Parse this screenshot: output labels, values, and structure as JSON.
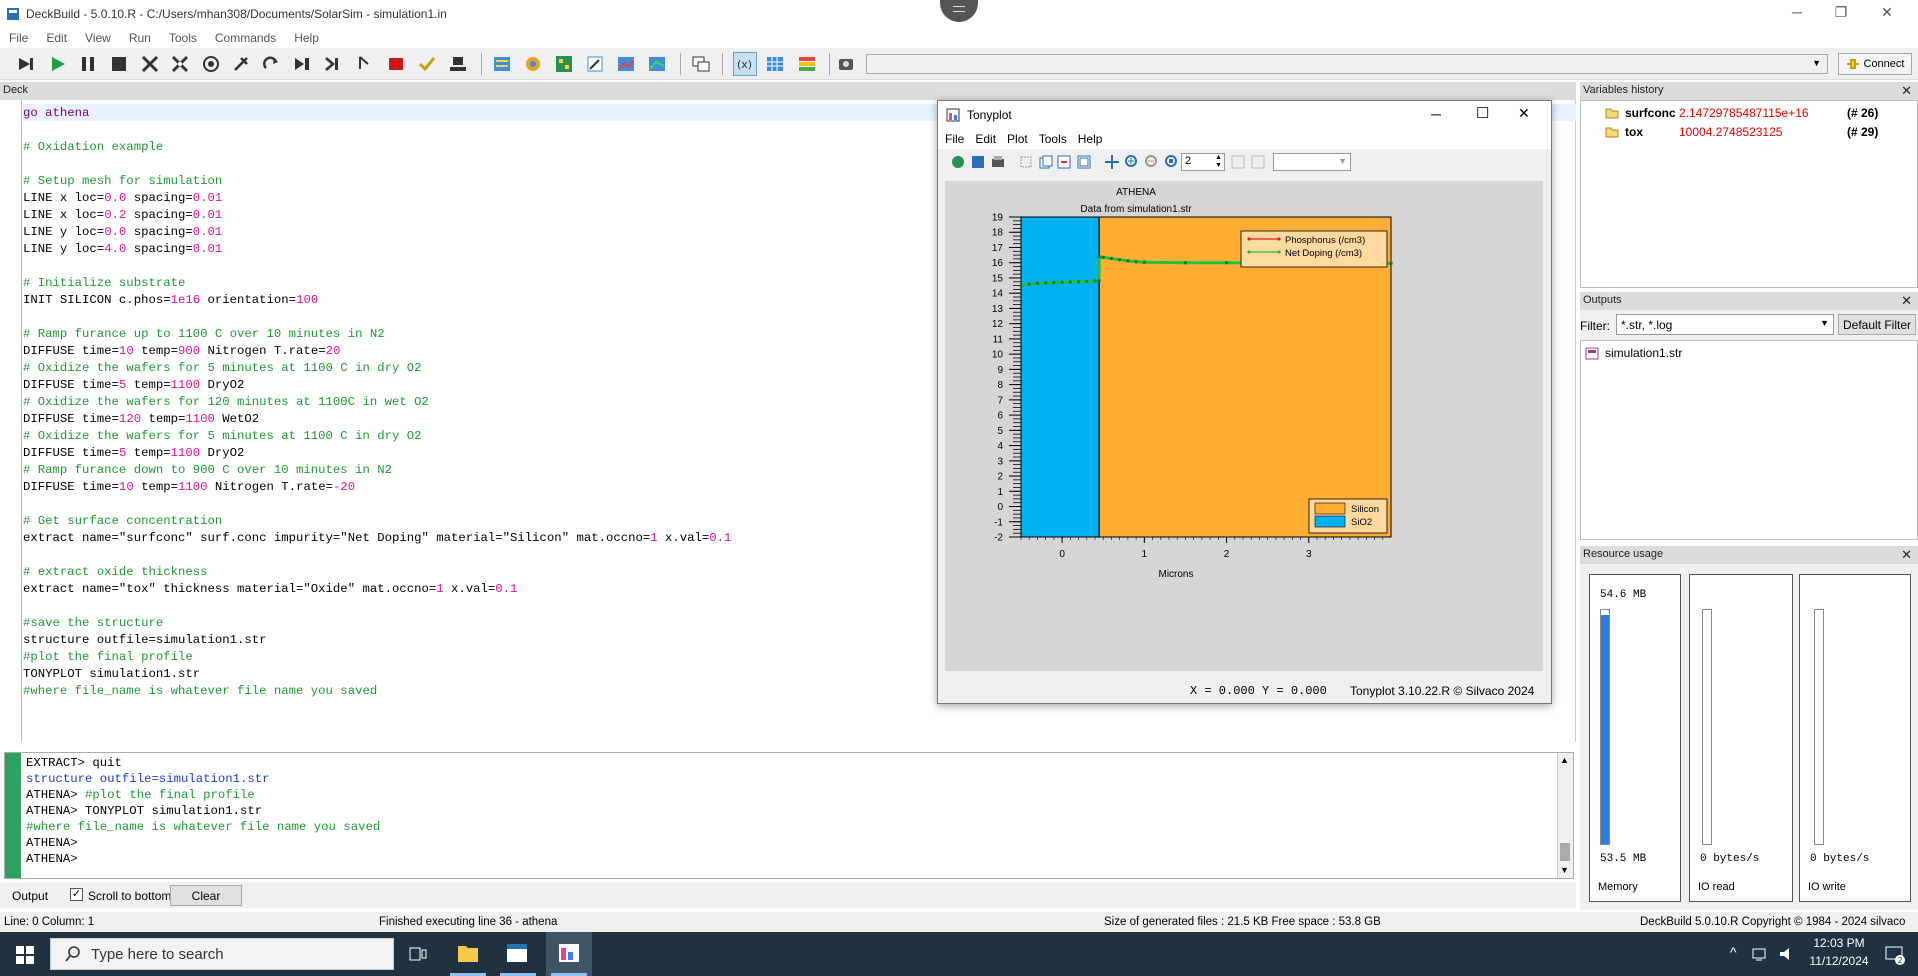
{
  "window": {
    "title": "DeckBuild - 5.0.10.R - C:/Users/mhan308/Documents/SolarSim - simulation1.in"
  },
  "menu": [
    "File",
    "Edit",
    "View",
    "Run",
    "Tools",
    "Commands",
    "Help"
  ],
  "toolbar": {
    "connect_label": "Connect"
  },
  "deck": {
    "header": "Deck",
    "lines": [
      {
        "t": "go athena",
        "c": "go"
      },
      {
        "t": "",
        "c": "kw"
      },
      {
        "t": "# Oxidation example",
        "c": "comment"
      },
      {
        "t": "",
        "c": "kw"
      },
      {
        "t": "# Setup mesh for simulation",
        "c": "comment"
      },
      {
        "t": "LINE x loc=0.0 spacing=0.01",
        "c": "kw"
      },
      {
        "t": "LINE x loc=0.2 spacing=0.01",
        "c": "kw"
      },
      {
        "t": "LINE y loc=0.0 spacing=0.01",
        "c": "kw"
      },
      {
        "t": "LINE y loc=4.0 spacing=0.01",
        "c": "kw"
      },
      {
        "t": "",
        "c": "kw"
      },
      {
        "t": "# Initialize substrate",
        "c": "comment"
      },
      {
        "t": "INIT SILICON c.phos=1e16 orientation=100",
        "c": "kw"
      },
      {
        "t": "",
        "c": "kw"
      },
      {
        "t": "# Ramp furance up to 1100 C over 10 minutes in N2",
        "c": "comment"
      },
      {
        "t": "DIFFUSE time=10 temp=900 Nitrogen T.rate=20",
        "c": "kw"
      },
      {
        "t": "# Oxidize the wafers for 5 minutes at 1100 C in dry O2",
        "c": "comment"
      },
      {
        "t": "DIFFUSE time=5 temp=1100 DryO2",
        "c": "kw"
      },
      {
        "t": "# Oxidize the wafers for 120 minutes at 1100C in wet O2",
        "c": "comment"
      },
      {
        "t": "DIFFUSE time=120 temp=1100 WetO2",
        "c": "kw"
      },
      {
        "t": "# Oxidize the wafers for 5 minutes at 1100 C in dry O2",
        "c": "comment"
      },
      {
        "t": "DIFFUSE time=5 temp=1100 DryO2",
        "c": "kw"
      },
      {
        "t": "# Ramp furance down to 900 C over 10 minutes in N2",
        "c": "comment"
      },
      {
        "t": "DIFFUSE time=10 temp=1100 Nitrogen T.rate=-20",
        "c": "kw"
      },
      {
        "t": "",
        "c": "kw"
      },
      {
        "t": "# Get surface concentration",
        "c": "comment"
      },
      {
        "t": "extract name=\"surfconc\" surf.conc impurity=\"Net Doping\" material=\"Silicon\" mat.occno=1 x.val=0.1",
        "c": "kw"
      },
      {
        "t": "",
        "c": "kw"
      },
      {
        "t": "# extract oxide thickness",
        "c": "comment"
      },
      {
        "t": "extract name=\"tox\" thickness material=\"Oxide\" mat.occno=1 x.val=0.1",
        "c": "kw"
      },
      {
        "t": "",
        "c": "kw"
      },
      {
        "t": "#save the structure",
        "c": "comment"
      },
      {
        "t": "structure outfile=simulation1.str",
        "c": "kw"
      },
      {
        "t": "#plot the final profile",
        "c": "comment"
      },
      {
        "t": "TONYPLOT simulation1.str",
        "c": "kw"
      },
      {
        "t": "#where file_name is whatever file name you saved",
        "c": "comment"
      }
    ]
  },
  "output": {
    "lines": [
      {
        "t": "EXTRACT> quit",
        "c": "plain"
      },
      {
        "t": "structure outfile=simulation1.str",
        "c": "blue"
      },
      {
        "t": "ATHENA> #plot the final profile",
        "c": "mixed"
      },
      {
        "t": "ATHENA> TONYPLOT simulation1.str",
        "c": "plain"
      },
      {
        "t": "#where file_name is whatever file name you saved",
        "c": "green"
      },
      {
        "t": "ATHENA>",
        "c": "plain"
      },
      {
        "t": "ATHENA>",
        "c": "plain"
      }
    ],
    "tab_label": "Output",
    "scroll_label": "Scroll to bottom",
    "clear_label": "Clear"
  },
  "variables": {
    "header": "Variables history",
    "items": [
      {
        "name": "surfconc",
        "value": "2.14729785487115e+16",
        "idx": "(# 26)"
      },
      {
        "name": "tox",
        "value": "10004.2748523125",
        "idx": "(# 29)"
      }
    ]
  },
  "outputs": {
    "header": "Outputs",
    "filter_label": "Filter:",
    "filter_value": "*.str, *.log",
    "default_filter": "Default Filter",
    "files": [
      "simulation1.str"
    ]
  },
  "resources": {
    "header": "Resource usage",
    "memory_top": "54.6 MB",
    "memory_bottom": "53.5 MB",
    "memory_label": "Memory",
    "memory_fill": 0.98,
    "ioread_val": "0 bytes/s",
    "ioread_label": "IO read",
    "iowrite_val": "0 bytes/s",
    "iowrite_label": "IO write"
  },
  "status": {
    "position": "Line: 0 Column: 1",
    "message": "Finished executing line 36 - athena",
    "sizes": "Size of generated files : 21.5 KB  Free space : 53.8 GB",
    "copyright": "DeckBuild 5.0.10.R Copyright © 1984 - 2024 silvaco"
  },
  "tonyplot": {
    "title": "Tonyplot",
    "menu": [
      "File",
      "Edit",
      "Plot",
      "Tools",
      "Help"
    ],
    "zoom_value": "2",
    "status_xy": "X = 0.000 Y = 0.000",
    "status_ver": "Tonyplot 3.10.22.R © Silvaco 2024"
  },
  "chart_data": {
    "type": "line",
    "title": "ATHENA",
    "subtitle": "Data from simulation1.str",
    "xlabel": "Microns",
    "ylabel": "",
    "xlim": [
      -0.5,
      4.0
    ],
    "ylim": [
      -2,
      19
    ],
    "xticks": [
      0,
      1,
      2,
      3
    ],
    "yticks": [
      -2,
      -1,
      0,
      1,
      2,
      3,
      4,
      5,
      6,
      7,
      8,
      9,
      10,
      11,
      12,
      13,
      14,
      15,
      16,
      17,
      18,
      19
    ],
    "regions": [
      {
        "name": "SiO2",
        "x": [
          -0.5,
          0.45
        ],
        "color": "#00b3f0"
      },
      {
        "name": "Silicon",
        "x": [
          0.45,
          4.0
        ],
        "color": "#ffae33"
      }
    ],
    "series": [
      {
        "name": "Phosphorus (/cm3)",
        "color": "#e02020",
        "x": [
          0.45,
          0.5,
          0.6,
          0.7,
          0.8,
          0.9,
          1.0,
          1.5,
          2.0,
          2.5,
          3.0,
          3.5,
          4.0
        ],
        "y": [
          16.4,
          16.35,
          16.28,
          16.2,
          16.12,
          16.07,
          16.03,
          16.0,
          16.0,
          16.0,
          16.0,
          16.0,
          16.0
        ]
      },
      {
        "name": "Net Doping (/cm3)",
        "color": "#22c040",
        "x": [
          -0.5,
          -0.4,
          -0.3,
          -0.2,
          -0.1,
          0.0,
          0.1,
          0.2,
          0.3,
          0.4,
          0.45,
          0.45,
          0.5,
          0.6,
          0.7,
          0.8,
          0.9,
          1.0,
          1.5,
          2.0,
          2.5,
          3.0,
          3.5,
          4.0
        ],
        "y": [
          14.5,
          14.6,
          14.65,
          14.68,
          14.7,
          14.72,
          14.74,
          14.76,
          14.78,
          14.8,
          14.82,
          16.4,
          16.35,
          16.28,
          16.2,
          16.12,
          16.07,
          16.03,
          16.0,
          16.0,
          16.0,
          16.0,
          16.0,
          15.95
        ]
      }
    ],
    "legend_position": "top-right",
    "region_legend_position": "bottom-right"
  }
}
